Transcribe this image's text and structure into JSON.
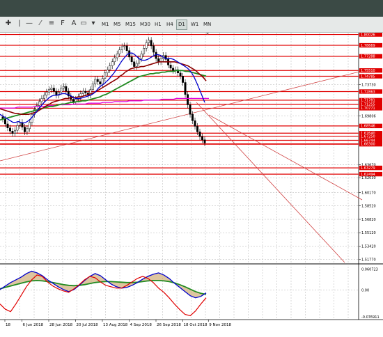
{
  "toolbar": {
    "timeframes": [
      "M1",
      "M5",
      "M15",
      "M30",
      "H1",
      "H4",
      "D1",
      "W1",
      "MN"
    ],
    "active_timeframe": "D1"
  },
  "colors": {
    "candles": "#000000",
    "ma_blue": "#0000cc",
    "ma_darkred": "#8b0000",
    "ma_green": "#228b22",
    "ma_magenta": "#e000e0",
    "levels": "#e00000",
    "osc_fill": "#c8a060"
  },
  "main_price_axis": [
    {
      "text": "1.80026",
      "y": 1.80026,
      "highlight": true
    },
    {
      "text": "1.78669",
      "y": 1.78669,
      "highlight": true
    },
    {
      "text": "1.77288",
      "y": 1.77288,
      "highlight": true
    },
    {
      "text": "1.75510",
      "y": 1.7551,
      "highlight": true
    },
    {
      "text": "1.74785",
      "y": 1.74785,
      "highlight": true
    },
    {
      "text": "1.73730",
      "y": 1.7373,
      "highlight": false
    },
    {
      "text": "1.72863",
      "y": 1.72863,
      "highlight": true
    },
    {
      "text": "1.71781",
      "y": 1.71781,
      "highlight": true
    },
    {
      "text": "1.71255",
      "y": 1.71255,
      "highlight": true
    },
    {
      "text": "1.70771",
      "y": 1.70771,
      "highlight": true
    },
    {
      "text": "1.69806",
      "y": 1.69806,
      "highlight": false
    },
    {
      "text": "1.68546",
      "y": 1.68546,
      "highlight": true
    },
    {
      "text": "1.67640",
      "y": 1.6764,
      "highlight": true
    },
    {
      "text": "1.67250",
      "y": 1.6725,
      "highlight": true
    },
    {
      "text": "1.66744",
      "y": 1.66744,
      "highlight": true
    },
    {
      "text": "1.66248",
      "y": 1.66248,
      "highlight": true
    },
    {
      "text": "1.66300",
      "y": 1.663,
      "highlight": true
    },
    {
      "text": "1.63670",
      "y": 1.6367,
      "highlight": false
    },
    {
      "text": "1.63279",
      "y": 1.63279,
      "highlight": true
    },
    {
      "text": "1.62494",
      "y": 1.62494,
      "highlight": true
    },
    {
      "text": "1.62030",
      "y": 1.6203,
      "highlight": false
    },
    {
      "text": "1.60170",
      "y": 1.6017,
      "highlight": false
    },
    {
      "text": "1.58520",
      "y": 1.5852,
      "highlight": false
    },
    {
      "text": "1.56820",
      "y": 1.5682,
      "highlight": false
    },
    {
      "text": "1.55120",
      "y": 1.5512,
      "highlight": false
    },
    {
      "text": "1.53420",
      "y": 1.5342,
      "highlight": false
    },
    {
      "text": "1.51770",
      "y": 1.5177,
      "highlight": false
    }
  ],
  "osc_axis": [
    {
      "text": "0.060723",
      "v": 0.060723
    },
    {
      "text": "0.00",
      "v": 0.0
    },
    {
      "text": "-0.076911",
      "v": -0.076911
    }
  ],
  "date_axis": [
    {
      "text": "18",
      "frac": 0.02
    },
    {
      "text": "6 Jun 2018",
      "frac": 0.09
    },
    {
      "text": "28 Jun 2018",
      "frac": 0.2
    },
    {
      "text": "20 Jul 2018",
      "frac": 0.31
    },
    {
      "text": "13 Aug 2018",
      "frac": 0.42
    },
    {
      "text": "4 Sep 2018",
      "frac": 0.53
    },
    {
      "text": "26 Sep 2018",
      "frac": 0.64
    },
    {
      "text": "18 Oct 2018",
      "frac": 0.75
    },
    {
      "text": "9 Nov 2018",
      "frac": 0.855
    }
  ],
  "chart_data": {
    "type": "line",
    "candle_closes": [
      1.694,
      1.688,
      1.683,
      1.679,
      1.676,
      1.68,
      1.686,
      1.69,
      1.684,
      1.678,
      1.682,
      1.69,
      1.7,
      1.706,
      1.711,
      1.716,
      1.72,
      1.724,
      1.728,
      1.731,
      1.733,
      1.729,
      1.724,
      1.728,
      1.733,
      1.735,
      1.729,
      1.723,
      1.719,
      1.716,
      1.719,
      1.722,
      1.726,
      1.729,
      1.727,
      1.724,
      1.731,
      1.738,
      1.744,
      1.741,
      1.738,
      1.745,
      1.752,
      1.756,
      1.761,
      1.766,
      1.771,
      1.776,
      1.781,
      1.785,
      1.786,
      1.78,
      1.772,
      1.766,
      1.76,
      1.764,
      1.77,
      1.776,
      1.783,
      1.79,
      1.793,
      1.786,
      1.778,
      1.77,
      1.766,
      1.77,
      1.774,
      1.769,
      1.762,
      1.758,
      1.755,
      1.756,
      1.752,
      1.748,
      1.74,
      1.725,
      1.712,
      1.7,
      1.692,
      1.685,
      1.678,
      1.672,
      1.668,
      1.664
    ],
    "ma_blue": [
      1.7,
      1.698,
      1.696,
      1.694,
      1.692,
      1.69,
      1.69,
      1.691,
      1.69,
      1.689,
      1.69,
      1.692,
      1.695,
      1.699,
      1.703,
      1.707,
      1.711,
      1.715,
      1.718,
      1.721,
      1.723,
      1.724,
      1.724,
      1.725,
      1.726,
      1.726,
      1.725,
      1.724,
      1.722,
      1.72,
      1.72,
      1.72,
      1.721,
      1.722,
      1.723,
      1.724,
      1.726,
      1.729,
      1.733,
      1.736,
      1.738,
      1.741,
      1.744,
      1.748,
      1.752,
      1.757,
      1.762,
      1.767,
      1.771,
      1.775,
      1.777,
      1.777,
      1.775,
      1.772,
      1.769,
      1.768,
      1.768,
      1.769,
      1.771,
      1.773,
      1.775,
      1.775,
      1.774,
      1.772,
      1.77,
      1.77,
      1.77,
      1.769,
      1.767,
      1.765,
      1.763,
      1.761,
      1.759,
      1.756,
      1.752,
      1.746,
      1.739,
      1.731,
      1.723,
      1.715
    ],
    "ma_darkred": [
      1.707,
      1.706,
      1.705,
      1.704,
      1.703,
      1.702,
      1.701,
      1.701,
      1.7,
      1.7,
      1.7,
      1.7,
      1.701,
      1.702,
      1.703,
      1.705,
      1.707,
      1.709,
      1.711,
      1.713,
      1.715,
      1.716,
      1.717,
      1.718,
      1.719,
      1.72,
      1.72,
      1.721,
      1.721,
      1.721,
      1.722,
      1.722,
      1.723,
      1.724,
      1.725,
      1.726,
      1.727,
      1.729,
      1.731,
      1.733,
      1.735,
      1.737,
      1.739,
      1.741,
      1.743,
      1.745,
      1.748,
      1.75,
      1.753,
      1.755,
      1.757,
      1.758,
      1.759,
      1.759,
      1.76,
      1.76,
      1.761,
      1.762,
      1.763,
      1.764,
      1.765,
      1.766,
      1.766,
      1.766,
      1.766,
      1.766,
      1.766,
      1.766,
      1.765,
      1.764,
      1.763,
      1.762,
      1.761,
      1.759,
      1.757,
      1.755,
      1.752,
      1.749,
      1.746,
      1.742
    ],
    "ma_green": [
      1.693,
      1.694,
      1.695,
      1.696,
      1.697,
      1.698,
      1.699,
      1.7,
      1.701,
      1.702,
      1.703,
      1.704,
      1.705,
      1.706,
      1.707,
      1.708,
      1.709,
      1.71,
      1.71,
      1.711,
      1.712,
      1.713,
      1.713,
      1.714,
      1.715,
      1.715,
      1.716,
      1.716,
      1.717,
      1.717,
      1.718,
      1.719,
      1.72,
      1.721,
      1.722,
      1.724,
      1.725,
      1.727,
      1.729,
      1.731,
      1.733,
      1.735,
      1.737,
      1.739,
      1.741,
      1.743,
      1.745,
      1.747,
      1.748,
      1.749,
      1.75,
      1.751,
      1.751,
      1.752,
      1.752,
      1.753,
      1.753,
      1.754,
      1.754,
      1.754,
      1.755,
      1.755,
      1.755,
      1.754,
      1.754,
      1.753,
      1.752,
      1.751,
      1.75,
      1.749,
      1.748
    ],
    "ma_magenta": [
      1.708,
      1.708,
      1.708,
      1.708,
      1.708,
      1.708,
      1.709,
      1.709,
      1.709,
      1.709,
      1.709,
      1.709,
      1.71,
      1.71,
      1.71,
      1.71,
      1.711,
      1.711,
      1.711,
      1.711,
      1.712,
      1.712,
      1.712,
      1.712,
      1.712,
      1.713,
      1.713,
      1.713,
      1.713,
      1.713,
      1.714,
      1.714,
      1.714,
      1.714,
      1.714,
      1.715,
      1.715,
      1.715,
      1.715,
      1.716,
      1.716,
      1.716,
      1.716,
      1.716,
      1.717,
      1.717,
      1.717,
      1.717,
      1.717,
      1.718,
      1.718,
      1.718,
      1.718,
      1.718,
      1.718,
      1.719,
      1.719,
      1.719,
      1.719,
      1.719,
      1.72,
      1.72,
      1.72,
      1.72,
      1.72,
      1.72,
      1.72,
      1.72,
      1.72,
      1.72,
      1.72,
      1.72
    ],
    "osc_main": [
      0.002,
      0.012,
      0.022,
      0.03,
      0.038,
      0.048,
      0.055,
      0.05,
      0.042,
      0.03,
      0.02,
      0.01,
      0.002,
      -0.004,
      0.002,
      0.014,
      0.028,
      0.04,
      0.048,
      0.042,
      0.03,
      0.018,
      0.01,
      0.006,
      0.008,
      0.014,
      0.022,
      0.032,
      0.04,
      0.046,
      0.05,
      0.044,
      0.034,
      0.02,
      0.008,
      -0.004,
      -0.016,
      -0.022,
      -0.018,
      -0.008
    ],
    "osc_red": [
      -0.04,
      -0.055,
      -0.062,
      -0.04,
      -0.015,
      0.01,
      0.03,
      0.044,
      0.04,
      0.024,
      0.012,
      0.004,
      -0.002,
      -0.006,
      0.004,
      0.016,
      0.03,
      0.04,
      0.036,
      0.024,
      0.014,
      0.01,
      0.006,
      0.006,
      0.014,
      0.024,
      0.034,
      0.04,
      0.034,
      0.022,
      0.006,
      -0.006,
      -0.022,
      -0.04,
      -0.056,
      -0.07,
      -0.074,
      -0.06,
      -0.04,
      -0.022
    ],
    "osc_green": [
      0.004,
      0.008,
      0.012,
      0.016,
      0.02,
      0.024,
      0.027,
      0.028,
      0.027,
      0.025,
      0.022,
      0.019,
      0.016,
      0.014,
      0.013,
      0.014,
      0.016,
      0.019,
      0.022,
      0.024,
      0.025,
      0.025,
      0.024,
      0.023,
      0.022,
      0.022,
      0.023,
      0.025,
      0.027,
      0.028,
      0.028,
      0.027,
      0.025,
      0.021,
      0.016,
      0.01,
      0.003,
      -0.004,
      -0.009,
      -0.012
    ]
  }
}
